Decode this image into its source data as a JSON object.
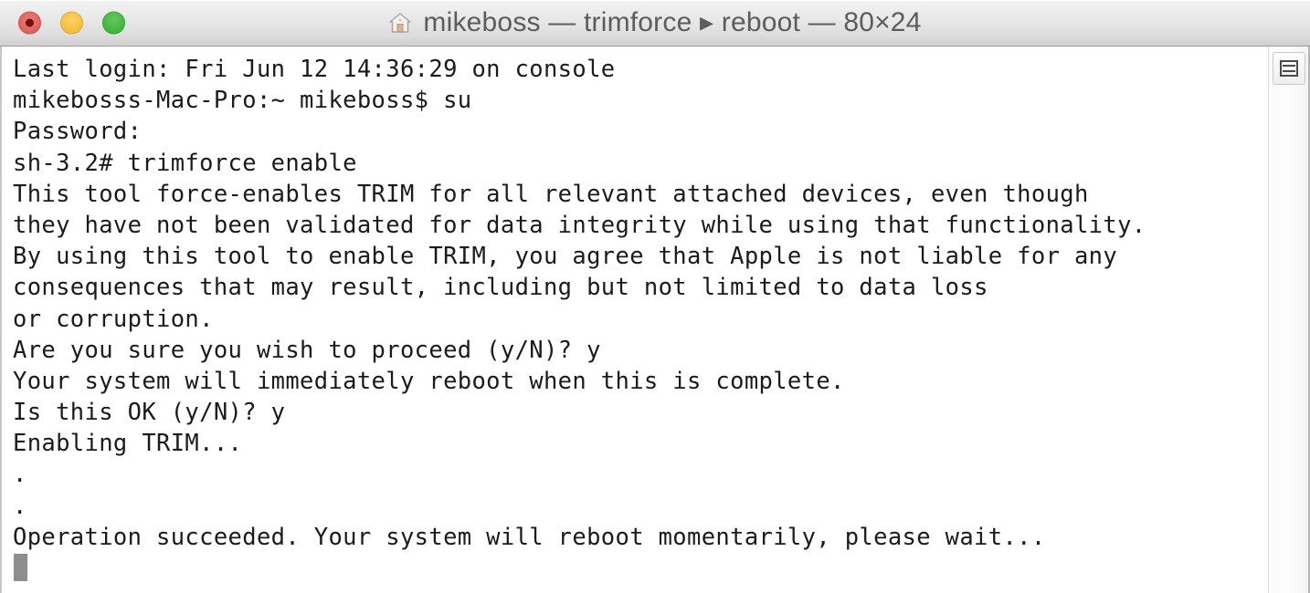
{
  "window": {
    "title": "mikeboss — trimforce ▸ reboot — 80×24",
    "home_icon": "home-icon",
    "size_cols": "80",
    "size_rows": "24",
    "colors": {
      "titlebar_top": "#f2f2f2",
      "titlebar_bottom": "#cfcfcf",
      "terminal_background": "#ffffff",
      "terminal_text": "#1b1b1b",
      "cursor": "#8d8d8d",
      "close_button": "#e2655f",
      "minimize_button": "#f6c242",
      "maximize_button": "#46b942"
    }
  },
  "traffic_lights": {
    "close_label": "Close",
    "minimize_label": "Minimize",
    "maximize_label": "Maximize"
  },
  "terminal": {
    "lines": [
      "Last login: Fri Jun 12 14:36:29 on console",
      "mikebosss-Mac-Pro:~ mikeboss$ su",
      "Password:",
      "sh-3.2# trimforce enable",
      "This tool force-enables TRIM for all relevant attached devices, even though",
      "they have not been validated for data integrity while using that functionality.",
      "By using this tool to enable TRIM, you agree that Apple is not liable for any",
      "consequences that may result, including but not limited to data loss",
      "or corruption.",
      "Are you sure you wish to proceed (y/N)? y",
      "Your system will immediately reboot when this is complete.",
      "Is this OK (y/N)? y",
      "Enabling TRIM...",
      ".",
      ".",
      "Operation succeeded. Your system will reboot momentarily, please wait..."
    ],
    "cursor_visible": true
  },
  "scrollbar": {
    "thumb_icon": "scroll-grip-icon",
    "position": "top"
  }
}
